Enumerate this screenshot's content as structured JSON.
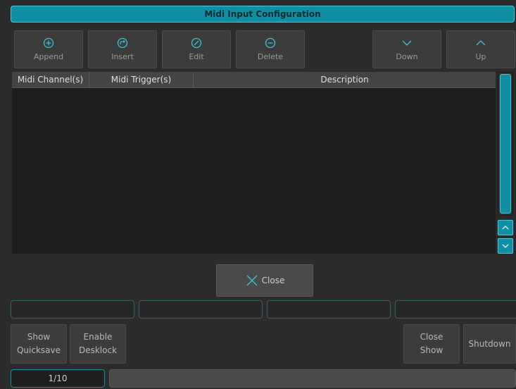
{
  "window": {
    "title": "Midi Input Configuration"
  },
  "toolbar": {
    "append": {
      "label": "Append",
      "icon": "plus-circle-icon"
    },
    "insert": {
      "label": "Insert",
      "icon": "insert-arrow-icon"
    },
    "edit": {
      "label": "Edit",
      "icon": "pencil-circle-icon"
    },
    "delete": {
      "label": "Delete",
      "icon": "minus-circle-icon"
    },
    "down": {
      "label": "Down",
      "icon": "chevron-down-icon"
    },
    "up": {
      "label": "Up",
      "icon": "chevron-up-icon"
    }
  },
  "table": {
    "columns": [
      "Midi Channel(s)",
      "Midi Trigger(s)",
      "Description"
    ],
    "rows": []
  },
  "dialog": {
    "close_label": "Close"
  },
  "bottom": {
    "show_quicksave": "Show\nQuicksave",
    "enable_desklock": "Enable\nDesklock",
    "close_show": "Close\nShow",
    "shutdown": "Shutdown"
  },
  "status": {
    "page": "1/10"
  },
  "colors": {
    "accent": "#0f8fa3",
    "accent_border": "#4fc6d6",
    "background": "#2b2b2b"
  }
}
